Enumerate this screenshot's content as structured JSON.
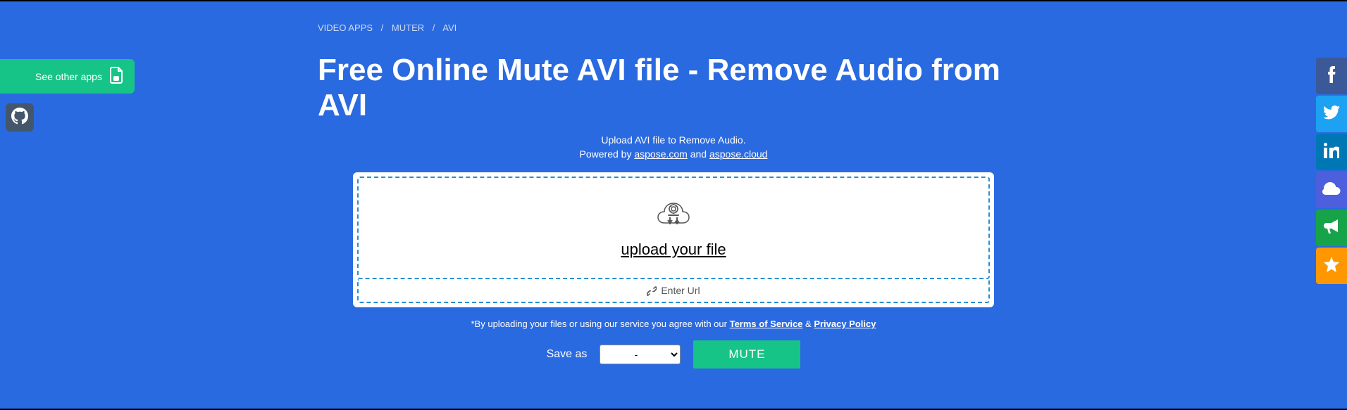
{
  "breadcrumb": {
    "item1": "VIDEO APPS",
    "item2": "MUTER",
    "item3": "AVI"
  },
  "heading": "Free Online Mute AVI file - Remove Audio from AVI",
  "subtitle": "Upload AVI file to Remove Audio.",
  "powered": {
    "prefix": "Powered by ",
    "link1": "aspose.com",
    "and": " and ",
    "link2": "aspose.cloud"
  },
  "upload": {
    "link_text": "upload your file",
    "enter_url": "Enter Url"
  },
  "agree": {
    "prefix": "*By uploading your files or using our service you agree with our ",
    "tos": "Terms of Service",
    "amp": " & ",
    "pp": "Privacy Policy"
  },
  "saveas": {
    "label": "Save as",
    "selected": "-",
    "options": [
      "-"
    ]
  },
  "mute_label": "MUTE",
  "left": {
    "see_other": "See other apps"
  }
}
